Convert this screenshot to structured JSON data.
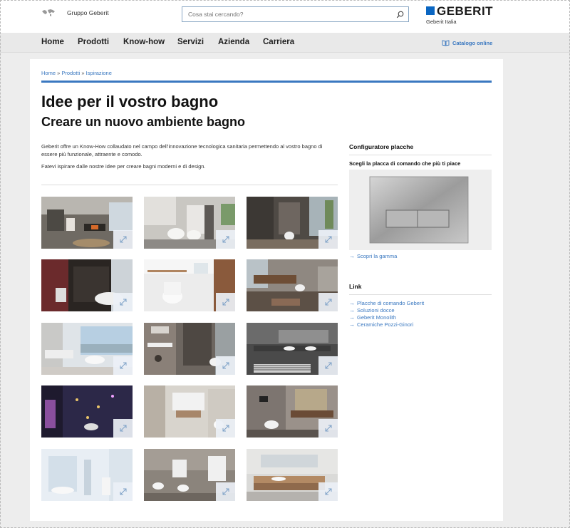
{
  "header": {
    "group_label": "Gruppo Geberit",
    "search_placeholder": "Cosa stai cercando?",
    "logo_text": "GEBERIT",
    "logo_subtitle": "Geberit Italia",
    "brand_color": "#0a66c2"
  },
  "nav": {
    "items": [
      "Home",
      "Prodotti",
      "Know-how",
      "Servizi",
      "Azienda",
      "Carriera"
    ],
    "catalog_label": "Catalogo online"
  },
  "breadcrumb": {
    "items": [
      "Home",
      "Prodotti",
      "Ispirazione"
    ],
    "separator": "»"
  },
  "main": {
    "title": "Idee per il vostro bagno",
    "subtitle": "Creare un nuovo ambiente bagno",
    "intro": "Geberit offre un Know-How collaudato nel campo dell'innovazione tecnologica sanitaria permettendo al vostro bagno di essere più funzionale, attraente e comodo.",
    "intro2": "Fatevi ispirare dalle nostre idee per creare bagni moderni e di design."
  },
  "gallery": {
    "count": 15,
    "expand_icon": "expand-arrows-icon"
  },
  "sidebar": {
    "config_title": "Configuratore placche",
    "config_subtitle": "Scegli la placca di comando che più ti piace",
    "scopri_label": "Scopri la gamma",
    "link_title": "Link",
    "links": [
      "Placche di comando Geberit",
      "Soluzioni docce",
      "Geberit Monolith",
      "Ceramiche Pozzi-Ginori"
    ]
  },
  "accent_color": "#3a78c0"
}
